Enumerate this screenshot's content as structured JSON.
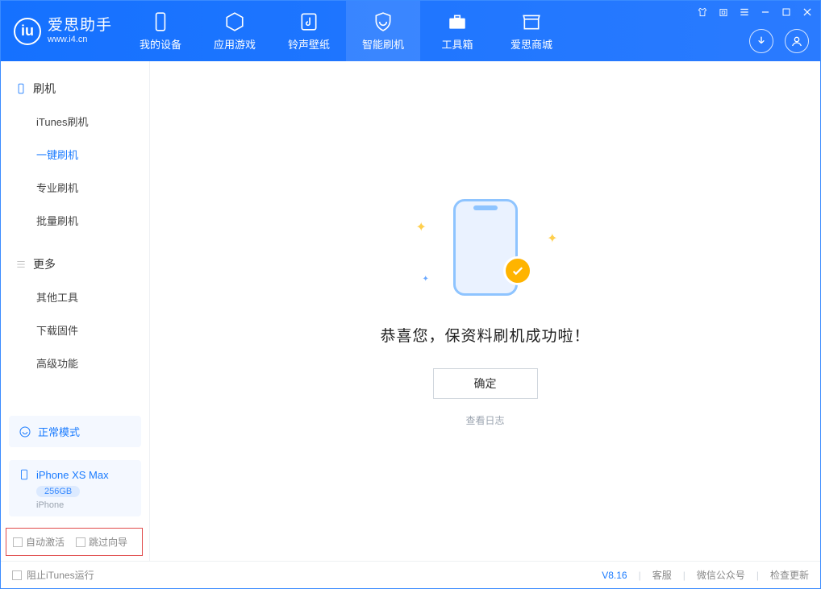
{
  "app": {
    "name_cn": "爱思助手",
    "name_en": "www.i4.cn"
  },
  "nav": {
    "items": [
      {
        "label": "我的设备"
      },
      {
        "label": "应用游戏"
      },
      {
        "label": "铃声壁纸"
      },
      {
        "label": "智能刷机"
      },
      {
        "label": "工具箱"
      },
      {
        "label": "爱思商城"
      }
    ]
  },
  "sidebar": {
    "group1": "刷机",
    "items1": [
      {
        "label": "iTunes刷机"
      },
      {
        "label": "一键刷机"
      },
      {
        "label": "专业刷机"
      },
      {
        "label": "批量刷机"
      }
    ],
    "group2": "更多",
    "items2": [
      {
        "label": "其他工具"
      },
      {
        "label": "下载固件"
      },
      {
        "label": "高级功能"
      }
    ],
    "mode": "正常模式",
    "device_name": "iPhone XS Max",
    "device_capacity": "256GB",
    "device_type": "iPhone",
    "chk_auto_activate": "自动激活",
    "chk_skip_wizard": "跳过向导"
  },
  "main": {
    "success_text": "恭喜您，保资料刷机成功啦！",
    "ok_label": "确定",
    "log_link": "查看日志"
  },
  "footer": {
    "block_itunes": "阻止iTunes运行",
    "version": "V8.16",
    "links": {
      "cs": "客服",
      "wechat": "微信公众号",
      "update": "检查更新"
    }
  }
}
